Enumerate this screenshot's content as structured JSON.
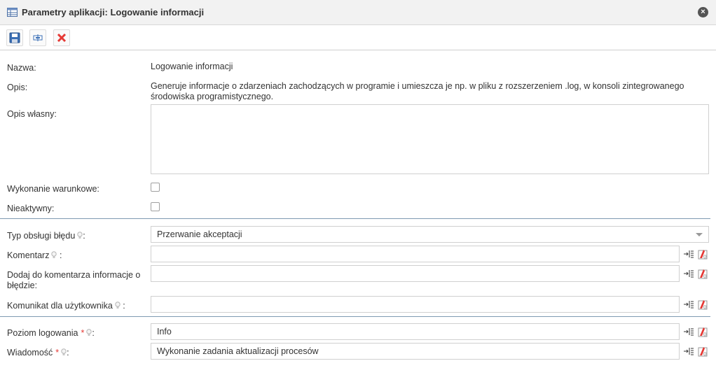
{
  "window": {
    "title": "Parametry aplikacji: Logowanie informacji",
    "close_icon": "close-icon"
  },
  "toolbar": {
    "buttons": [
      "save-icon",
      "insert-icon",
      "delete-icon"
    ]
  },
  "form": {
    "name": {
      "label": "Nazwa:",
      "value": "Logowanie informacji"
    },
    "description": {
      "label": "Opis:",
      "value_line1": "Generuje informacje o zdarzeniach zachodzących w programie i umieszcza je np. w pliku z rozszerzeniem .log, w konsoli zintegrowanego",
      "value_line2": "środowiska programistycznego."
    },
    "own_description": {
      "label": "Opis własny:",
      "value": ""
    },
    "conditional": {
      "label": "Wykonanie warunkowe:",
      "checked": false
    },
    "inactive": {
      "label": "Nieaktywny:",
      "checked": false
    },
    "error_type": {
      "label": "Typ obsługi błędu",
      "suffix": ":",
      "value": "Przerwanie akceptacji"
    },
    "comment": {
      "label": "Komentarz",
      "suffix": ":",
      "value": ""
    },
    "add_error": {
      "label_line1": "Dodaj do komentarza informacje o",
      "label_line2": "błędzie:",
      "value": ""
    },
    "user_message": {
      "label": "Komunikat dla użytkownika",
      "suffix": ":",
      "value": ""
    },
    "log_level": {
      "label": "Poziom logowania",
      "required": "*",
      "suffix": ":",
      "value": "Info"
    },
    "message": {
      "label": "Wiadomość",
      "required": "*",
      "suffix": ":",
      "value": "Wykonanie zadania aktualizacji procesów"
    }
  },
  "colors": {
    "separator": "#7f9ab2",
    "required": "#e53935",
    "delete": "#e53935"
  }
}
